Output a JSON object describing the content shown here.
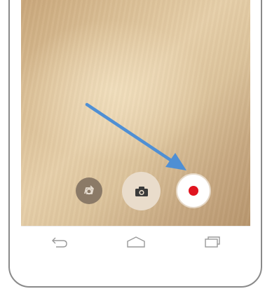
{
  "camera": {
    "controls": [
      {
        "name": "switch-camera-button",
        "icon": "switch-camera-icon"
      },
      {
        "name": "take-photo-button",
        "icon": "camera-icon"
      },
      {
        "name": "record-video-button",
        "icon": "record-icon"
      }
    ],
    "record_color": "#e0141f"
  },
  "navigation_bar": {
    "items": [
      {
        "name": "back-button",
        "icon": "back-icon"
      },
      {
        "name": "home-button",
        "icon": "home-icon"
      },
      {
        "name": "recent-apps-button",
        "icon": "recent-apps-icon"
      }
    ]
  },
  "annotation": {
    "arrow_color": "#4f8fd4",
    "points_to": "record-video-button"
  }
}
